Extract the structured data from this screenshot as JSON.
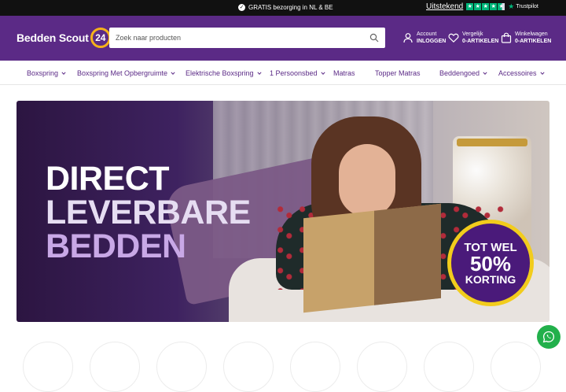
{
  "topbar": {
    "announcement": "GRATIS bezorging in NL & BE",
    "trustpilot_rating_word": "Uitstekend",
    "trustpilot_stars": 4.5,
    "trustpilot_brand": "Trustpilot"
  },
  "header": {
    "logo_text": "Bedden Scout",
    "logo_number": "24",
    "search_placeholder": "Zoek naar producten",
    "account": {
      "line1": "Account",
      "line2": "INLOGGEN"
    },
    "wishlist": {
      "line1": "Vergelijk",
      "count": "0",
      "suffix": "-ARTIKELEN"
    },
    "cart": {
      "line1": "Winkelwagen",
      "count": "0",
      "suffix": "-ARTIKELEN"
    }
  },
  "nav": {
    "items": [
      {
        "label": "Boxspring",
        "dropdown": true
      },
      {
        "label": "Boxspring Met Opbergruimte",
        "dropdown": true
      },
      {
        "label": "Elektrische Boxspring",
        "dropdown": true
      },
      {
        "label": "1 Persoonsbed",
        "dropdown": true
      },
      {
        "label": "Matras",
        "dropdown": false
      },
      {
        "label": "Topper Matras",
        "dropdown": false
      },
      {
        "label": "Beddengoed",
        "dropdown": true
      },
      {
        "label": "Accessoires",
        "dropdown": true
      }
    ]
  },
  "hero": {
    "line1": "DIRECT",
    "line2": "LEVERBARE",
    "line3": "BEDDEN",
    "badge_line1": "TOT WEL",
    "badge_line2": "50%",
    "badge_line3": "KORTING"
  },
  "colors": {
    "brand_purple": "#5b2a86",
    "accent_yellow": "#f6b21a",
    "trustpilot_green": "#00b67a",
    "whatsapp_green": "#22b04b"
  },
  "icons": {
    "search": "search-icon",
    "account": "user-icon",
    "wishlist": "heart-icon",
    "cart": "bag-icon",
    "chat": "whatsapp-icon"
  }
}
